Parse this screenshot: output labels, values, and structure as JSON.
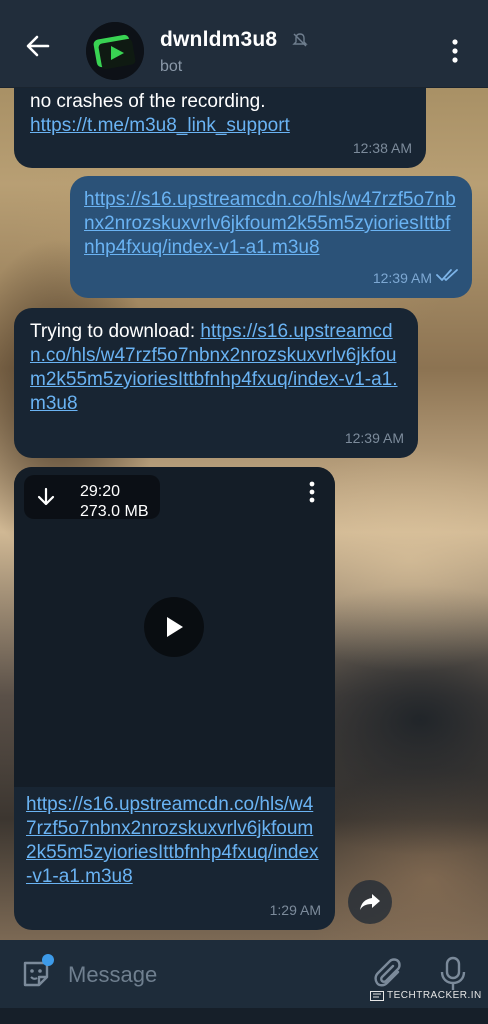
{
  "header": {
    "title": "dwnldm3u8",
    "subtitle": "bot"
  },
  "messages": [
    {
      "direction": "in",
      "text": "no crashes of the recording.",
      "link": "https://t.me/m3u8_link_support",
      "time": "12:38 AM"
    },
    {
      "direction": "out",
      "link": "https://s16.upstreamcdn.co/hls/w47rzf5o7nbnx2nrozskuxvrlv6jkfoum2k55m5zyioriesIttbfnhp4fxuq/index-v1-a1.m3u8",
      "time": "12:39 AM",
      "status": "read"
    },
    {
      "direction": "in",
      "text": "Trying to download: ",
      "link": "https://s16.upstreamcdn.co/hls/w47rzf5o7nbnx2nrozskuxvrlv6jkfoum2k55m5zyioriesIttbfnhp4fxuq/index-v1-a1.m3u8",
      "time": "12:39 AM"
    },
    {
      "direction": "in",
      "type": "video",
      "duration": "29:20",
      "size": "273.0 MB",
      "link": "https://s16.upstreamcdn.co/hls/w47rzf5o7nbnx2nrozskuxvrlv6jkfoum2k55m5zyioriesIttbfnhp4fxuq/index-v1-a1.m3u8",
      "time": "1:29 AM"
    }
  ],
  "input": {
    "placeholder": "Message"
  },
  "watermark": "TECHTRACKER.IN",
  "icons": {
    "back": "arrow-left-icon",
    "mute": "muted-bell-icon",
    "more": "more-vertical-icon",
    "download": "download-arrow-icon",
    "play": "play-icon",
    "share": "share-arrow-icon",
    "sticker": "sticker-icon",
    "attach": "paperclip-icon",
    "mic": "microphone-icon"
  },
  "colors": {
    "header_bg": "#212d3b",
    "incoming_bubble": "#182533",
    "outgoing_bubble": "#2b5278",
    "link": "#6ab3f3",
    "accent": "#3d9be9"
  }
}
